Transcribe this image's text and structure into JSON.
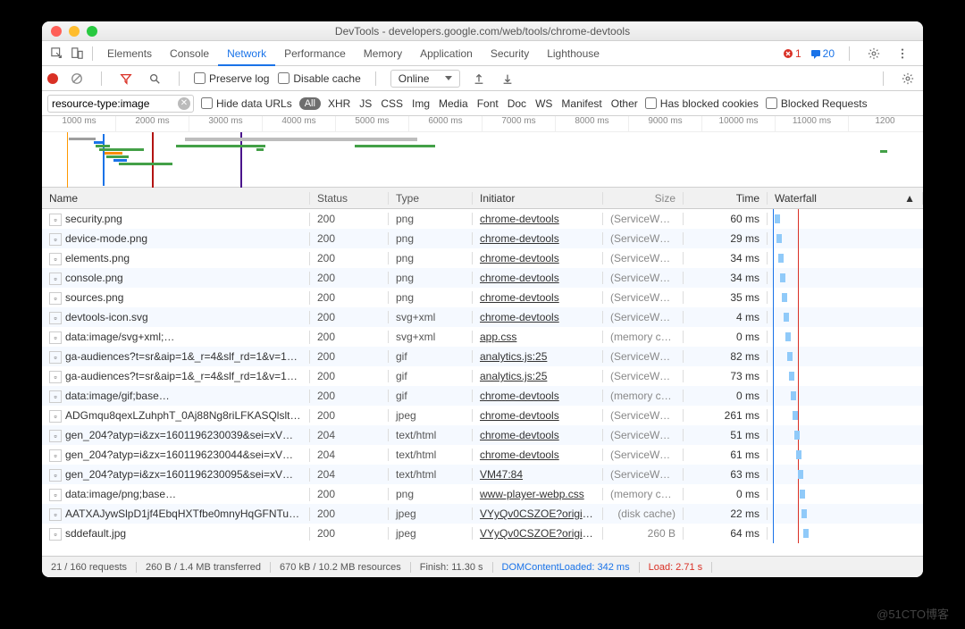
{
  "window": {
    "title": "DevTools - developers.google.com/web/tools/chrome-devtools"
  },
  "tabs": {
    "items": [
      "Elements",
      "Console",
      "Network",
      "Performance",
      "Memory",
      "Application",
      "Security",
      "Lighthouse"
    ],
    "active": "Network",
    "errors": "1",
    "messages": "20"
  },
  "toolbar": {
    "preserve_log": "Preserve log",
    "disable_cache": "Disable cache",
    "throttle": "Online"
  },
  "filter": {
    "value": "resource-type:image",
    "hide_urls": "Hide data URLs",
    "pill": "All",
    "types": [
      "XHR",
      "JS",
      "CSS",
      "Img",
      "Media",
      "Font",
      "Doc",
      "WS",
      "Manifest",
      "Other"
    ],
    "blocked_cookies": "Has blocked cookies",
    "blocked_requests": "Blocked Requests"
  },
  "timeline": {
    "ticks": [
      "1000 ms",
      "2000 ms",
      "3000 ms",
      "4000 ms",
      "5000 ms",
      "6000 ms",
      "7000 ms",
      "8000 ms",
      "9000 ms",
      "10000 ms",
      "11000 ms",
      "1200"
    ]
  },
  "columns": {
    "name": "Name",
    "status": "Status",
    "type": "Type",
    "initiator": "Initiator",
    "size": "Size",
    "time": "Time",
    "waterfall": "Waterfall"
  },
  "rows": [
    {
      "name": "security.png",
      "status": "200",
      "type": "png",
      "initiator": "chrome-devtools",
      "size": "(ServiceWor…",
      "time": "60 ms"
    },
    {
      "name": "device-mode.png",
      "status": "200",
      "type": "png",
      "initiator": "chrome-devtools",
      "size": "(ServiceWor…",
      "time": "29 ms"
    },
    {
      "name": "elements.png",
      "status": "200",
      "type": "png",
      "initiator": "chrome-devtools",
      "size": "(ServiceWor…",
      "time": "34 ms"
    },
    {
      "name": "console.png",
      "status": "200",
      "type": "png",
      "initiator": "chrome-devtools",
      "size": "(ServiceWor…",
      "time": "34 ms"
    },
    {
      "name": "sources.png",
      "status": "200",
      "type": "png",
      "initiator": "chrome-devtools",
      "size": "(ServiceWor…",
      "time": "35 ms"
    },
    {
      "name": "devtools-icon.svg",
      "status": "200",
      "type": "svg+xml",
      "initiator": "chrome-devtools",
      "size": "(ServiceWor…",
      "time": "4 ms"
    },
    {
      "name": "data:image/svg+xml;…",
      "status": "200",
      "type": "svg+xml",
      "initiator": "app.css",
      "size": "(memory ca…",
      "time": "0 ms"
    },
    {
      "name": "ga-audiences?t=sr&aip=1&_r=4&slf_rd=1&v=1…",
      "status": "200",
      "type": "gif",
      "initiator": "analytics.js:25",
      "size": "(ServiceWor…",
      "time": "82 ms"
    },
    {
      "name": "ga-audiences?t=sr&aip=1&_r=4&slf_rd=1&v=1…",
      "status": "200",
      "type": "gif",
      "initiator": "analytics.js:25",
      "size": "(ServiceWor…",
      "time": "73 ms"
    },
    {
      "name": "data:image/gif;base…",
      "status": "200",
      "type": "gif",
      "initiator": "chrome-devtools",
      "size": "(memory ca…",
      "time": "0 ms"
    },
    {
      "name": "ADGmqu8qexLZuhphT_0Aj88Ng8riLFKASQlslt…",
      "status": "200",
      "type": "jpeg",
      "initiator": "chrome-devtools",
      "size": "(ServiceWor…",
      "time": "261 ms"
    },
    {
      "name": "gen_204?atyp=i&zx=1601196230039&sei=xV…",
      "status": "204",
      "type": "text/html",
      "initiator": "chrome-devtools",
      "size": "(ServiceWor…",
      "time": "51 ms"
    },
    {
      "name": "gen_204?atyp=i&zx=1601196230044&sei=xV…",
      "status": "204",
      "type": "text/html",
      "initiator": "chrome-devtools",
      "size": "(ServiceWor…",
      "time": "61 ms"
    },
    {
      "name": "gen_204?atyp=i&zx=1601196230095&sei=xV…",
      "status": "204",
      "type": "text/html",
      "initiator": "VM47:84",
      "size": "(ServiceWor…",
      "time": "63 ms"
    },
    {
      "name": "data:image/png;base…",
      "status": "200",
      "type": "png",
      "initiator": "www-player-webp.css",
      "size": "(memory ca…",
      "time": "0 ms"
    },
    {
      "name": "AATXAJywSlpD1jf4EbqHXTfbe0mnyHqGFNTu…",
      "status": "200",
      "type": "jpeg",
      "initiator": "VYyQv0CSZOE?origin…",
      "size": "(disk cache)",
      "time": "22 ms"
    },
    {
      "name": "sddefault.jpg",
      "status": "200",
      "type": "jpeg",
      "initiator": "VYyQv0CSZOE?origin…",
      "size": "260 B",
      "time": "64 ms"
    }
  ],
  "footer": {
    "requests": "21 / 160 requests",
    "transferred": "260 B / 1.4 MB transferred",
    "resources": "670 kB / 10.2 MB resources",
    "finish": "Finish: 11.30 s",
    "dcl": "DOMContentLoaded: 342 ms",
    "load": "Load: 2.71 s"
  },
  "watermark": "@51CTO博客"
}
